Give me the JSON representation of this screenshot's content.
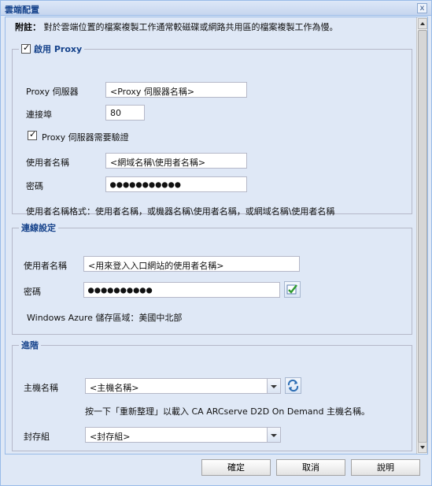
{
  "window": {
    "title": "雲端配置",
    "close_glyph": "x"
  },
  "note": {
    "label": "附註：",
    "text": "對於雲端位置的檔案複製工作通常較磁碟或網路共用區的檔案複製工作為慢。"
  },
  "proxy": {
    "legend": "啟用 Proxy",
    "enabled": true,
    "server_label": "Proxy 伺服器",
    "server_placeholder": "<Proxy 伺服器名稱>",
    "port_label": "連接埠",
    "port_value": "80",
    "auth_label": "Proxy 伺服器需要驗證",
    "auth_enabled": true,
    "username_label": "使用者名稱",
    "username_placeholder": "<網域名稱\\使用者名稱>",
    "password_label": "密碼",
    "password_value": "●●●●●●●●●●●",
    "format_hint": "使用者名稱格式：使用者名稱，或機器名稱\\使用者名稱，或網域名稱\\使用者名稱"
  },
  "connection": {
    "legend": "連線設定",
    "username_label": "使用者名稱",
    "username_placeholder": "<用來登入入口網站的使用者名稱>",
    "password_label": "密碼",
    "password_value": "●●●●●●●●●●",
    "region_label": "Windows Azure 儲存區域：",
    "region_value": "美國中北部"
  },
  "advanced": {
    "legend": "進階",
    "host_label": "主機名稱",
    "host_placeholder": "<主機名稱>",
    "refresh_hint": "按一下「重新整理」以載入 CA ARCserve D2D On Demand 主機名稱。",
    "archive_label": "封存組",
    "archive_placeholder": "<封存組>"
  },
  "buttons": {
    "ok": "確定",
    "cancel": "取消",
    "help": "說明"
  },
  "icons": {
    "verify": "check-verify-icon",
    "refresh": "refresh-icon"
  }
}
